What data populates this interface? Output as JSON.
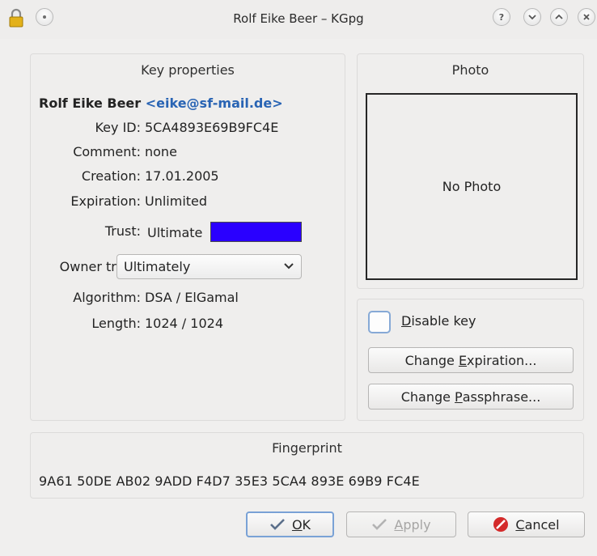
{
  "window": {
    "title": "Rolf Eike Beer – KGpg",
    "help_glyph": "?"
  },
  "key_properties": {
    "header": "Key properties",
    "owner_name": "Rolf Eike Beer",
    "owner_email": "<eike@sf-mail.de>",
    "fields": [
      {
        "label": "Key ID:",
        "value": "5CA4893E69B9FC4E"
      },
      {
        "label": "Comment:",
        "value": "none"
      },
      {
        "label": "Creation:",
        "value": "17.01.2005"
      },
      {
        "label": "Expiration:",
        "value": "Unlimited"
      },
      {
        "label": "Trust:",
        "value": "Ultimate"
      },
      {
        "label": "Owner trust:",
        "value": "Ultimately"
      },
      {
        "label": "Algorithm:",
        "value": "DSA / ElGamal"
      },
      {
        "label": "Length:",
        "value": "1024 / 1024"
      }
    ],
    "trust_color": "#2a00ff"
  },
  "photo": {
    "header": "Photo",
    "placeholder": "No Photo"
  },
  "actions": {
    "disable_key": {
      "prefix": "",
      "mnemonic": "D",
      "rest": "isable key",
      "checked": false
    },
    "change_expiration": {
      "prefix": "Change ",
      "mnemonic": "E",
      "rest": "xpiration..."
    },
    "change_passphrase": {
      "prefix": "Change ",
      "mnemonic": "P",
      "rest": "assphrase..."
    }
  },
  "fingerprint": {
    "header": "Fingerprint",
    "value": "9A61 50DE AB02 9ADD F4D7 35E3 5CA4 893E 69B9 FC4E"
  },
  "buttons": {
    "ok": {
      "mnemonic": "O",
      "rest": "K"
    },
    "apply": {
      "mnemonic": "A",
      "rest": "pply"
    },
    "cancel": {
      "mnemonic": "C",
      "rest": "ancel"
    }
  },
  "colors": {
    "accent": "#2964b4",
    "focus_border": "#7aa2d6",
    "cancel_icon": "#d42a2a"
  }
}
